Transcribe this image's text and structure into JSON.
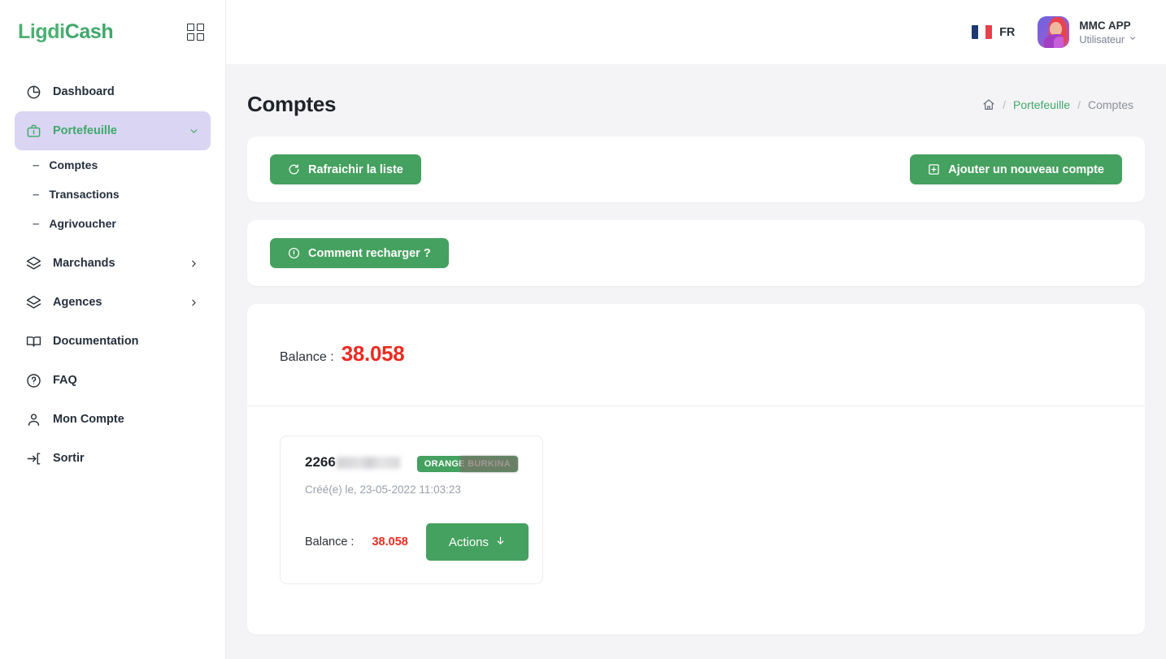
{
  "brand": {
    "part1": "Ligdi",
    "part2": "Cash"
  },
  "sidebar": {
    "grid_icon": "grid-icon",
    "items": [
      {
        "label": "Dashboard",
        "icon": "pie-chart-icon",
        "active": false
      },
      {
        "label": "Portefeuille",
        "icon": "briefcase-icon",
        "active": true,
        "chevron": "chevron-down-icon"
      },
      {
        "label": "Marchands",
        "icon": "layers-icon",
        "active": false,
        "chevron": "chevron-right-icon"
      },
      {
        "label": "Agences",
        "icon": "layers-icon",
        "active": false,
        "chevron": "chevron-right-icon"
      },
      {
        "label": "Documentation",
        "icon": "book-icon",
        "active": false
      },
      {
        "label": "FAQ",
        "icon": "question-circle-icon",
        "active": false
      },
      {
        "label": "Mon Compte",
        "icon": "user-icon",
        "active": false
      },
      {
        "label": "Sortir",
        "icon": "logout-icon",
        "active": false
      }
    ],
    "sub_items": [
      {
        "label": "Comptes",
        "dash": "–"
      },
      {
        "label": "Transactions",
        "dash": "–"
      },
      {
        "label": "Agrivoucher",
        "dash": "–"
      }
    ]
  },
  "topbar": {
    "language": "FR",
    "flag_icon": "france-flag-icon",
    "user_name": "MMC APP",
    "user_role": "Utilisateur",
    "user_chevron": "chevron-down-icon",
    "avatar_icon": "avatar"
  },
  "page": {
    "title": "Comptes",
    "breadcrumb": {
      "home_icon": "home-icon",
      "sep": "/",
      "link": "Portefeuille",
      "current": "Comptes"
    }
  },
  "toolbar": {
    "refresh_label": "Rafraichir la liste",
    "refresh_icon": "refresh-icon",
    "add_label": "Ajouter un nouveau compte",
    "add_icon": "plus-square-icon",
    "help_label": "Comment recharger ?",
    "help_icon": "info-circle-icon"
  },
  "balance": {
    "label": "Balance :",
    "value": "38.058"
  },
  "accounts": [
    {
      "number": "2266",
      "number_redacted": true,
      "badge": "ORANGE BURKINA",
      "badge_redacted": true,
      "created": "Créé(e) le, 23-05-2022 11:03:23",
      "balance_label": "Balance :",
      "balance_value": "38.058",
      "actions_label": "Actions",
      "actions_icon": "arrow-down-icon"
    }
  ],
  "colors": {
    "brand_green": "#4caf72",
    "button_green": "#45a15f",
    "balance_red": "#ec2b22",
    "active_nav_bg": "#d9d5f3",
    "page_bg": "#f4f4f6"
  }
}
